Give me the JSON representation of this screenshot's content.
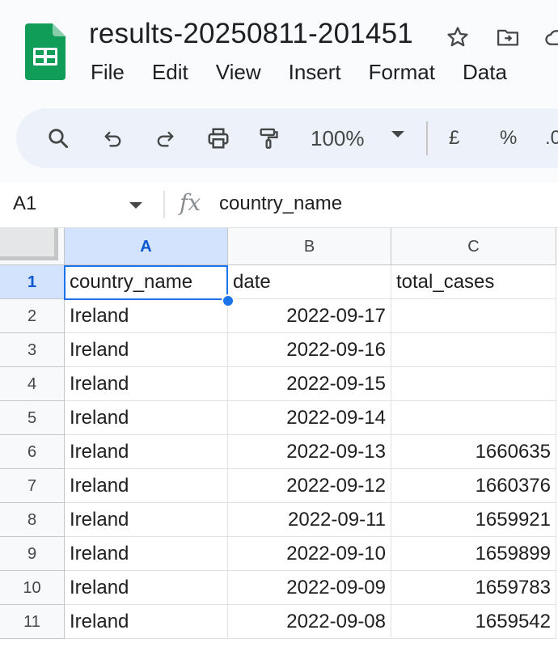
{
  "document": {
    "title": "results-20250811-201451",
    "logo_icon": "google-sheets-icon"
  },
  "menu": [
    "File",
    "Edit",
    "View",
    "Insert",
    "Format",
    "Data"
  ],
  "toolbar": {
    "zoom": "100%",
    "currency": "£",
    "percent": "%",
    "decimal": ".0"
  },
  "formula_bar": {
    "cell_ref": "A1",
    "fx": "fx",
    "content": "country_name"
  },
  "grid": {
    "columns": [
      "A",
      "B",
      "C"
    ],
    "rows": [
      {
        "n": "1",
        "cells": [
          "country_name",
          "date",
          "total_cases"
        ]
      },
      {
        "n": "2",
        "cells": [
          "Ireland",
          "2022-09-17",
          ""
        ]
      },
      {
        "n": "3",
        "cells": [
          "Ireland",
          "2022-09-16",
          ""
        ]
      },
      {
        "n": "4",
        "cells": [
          "Ireland",
          "2022-09-15",
          ""
        ]
      },
      {
        "n": "5",
        "cells": [
          "Ireland",
          "2022-09-14",
          ""
        ]
      },
      {
        "n": "6",
        "cells": [
          "Ireland",
          "2022-09-13",
          "1660635"
        ]
      },
      {
        "n": "7",
        "cells": [
          "Ireland",
          "2022-09-12",
          "1660376"
        ]
      },
      {
        "n": "8",
        "cells": [
          "Ireland",
          "2022-09-11",
          "1659921"
        ]
      },
      {
        "n": "9",
        "cells": [
          "Ireland",
          "2022-09-10",
          "1659899"
        ]
      },
      {
        "n": "10",
        "cells": [
          "Ireland",
          "2022-09-09",
          "1659783"
        ]
      },
      {
        "n": "11",
        "cells": [
          "Ireland",
          "2022-09-08",
          "1659542"
        ]
      }
    ]
  },
  "colors": {
    "accent": "#1a73e8",
    "header_active": "#d3e3fd",
    "toolbar_bg": "#edf2fa",
    "sheets_green": "#0f9d58"
  }
}
